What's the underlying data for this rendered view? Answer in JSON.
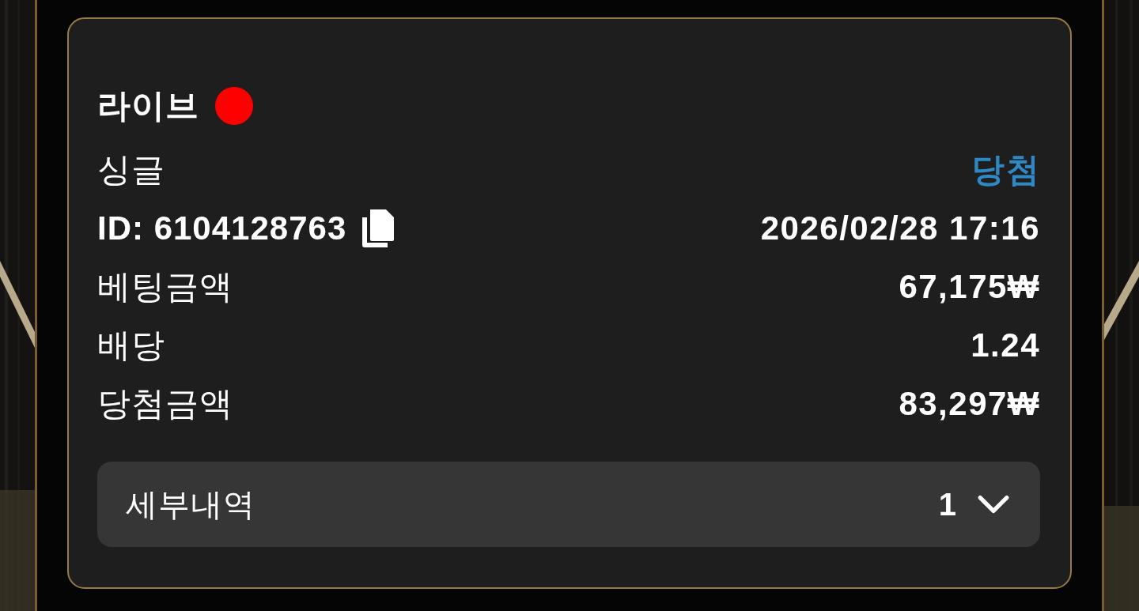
{
  "card": {
    "title": "라이브",
    "live": true,
    "rows": [
      {
        "kind": "status",
        "label": "싱글",
        "value": "당첨"
      },
      {
        "kind": "id",
        "label": "ID: 6104128763",
        "value": "2026/02/28 17:16"
      },
      {
        "kind": "amount",
        "label": "베팅금액",
        "value": "67,175₩"
      },
      {
        "kind": "amount",
        "label": "배당",
        "value": "1.24"
      },
      {
        "kind": "amount",
        "label": "당첨금액",
        "value": "83,297₩"
      }
    ],
    "details": {
      "label": "세부내역",
      "count": "1",
      "expanded": false
    }
  }
}
